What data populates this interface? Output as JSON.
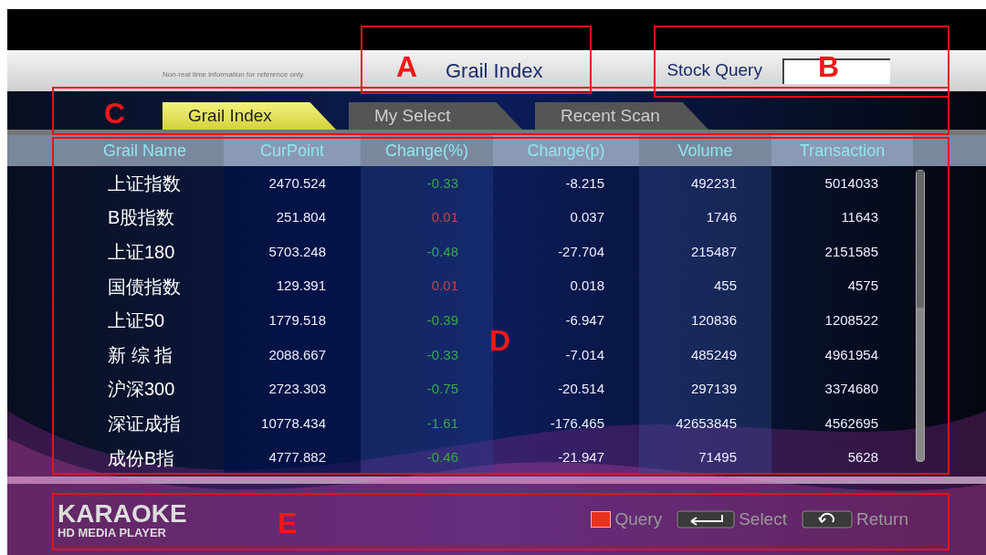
{
  "header": {
    "notice": "Non-real time information for reference only.",
    "title": "Grail Index",
    "query_label": "Stock Query"
  },
  "tabs": [
    {
      "label": "Grail Index",
      "selected": true
    },
    {
      "label": "My Select",
      "selected": false
    },
    {
      "label": "Recent Scan",
      "selected": false
    }
  ],
  "table": {
    "columns": [
      "Grail Name",
      "CurPoint",
      "Change(%)",
      "Change(p)",
      "Volume",
      "Transaction"
    ],
    "rows": [
      {
        "name": "上证指数",
        "cur_point": "2470.524",
        "change_pct": "-0.33",
        "color": "#3aa64a",
        "change_p": "-8.215",
        "volume": "492231",
        "transaction": "5014033"
      },
      {
        "name": "B股指数",
        "cur_point": "251.804",
        "change_pct": "0.01",
        "color": "#c8424a",
        "change_p": "0.037",
        "volume": "1746",
        "transaction": "11643"
      },
      {
        "name": "上证180",
        "cur_point": "5703.248",
        "change_pct": "-0.48",
        "color": "#3aa64a",
        "change_p": "-27.704",
        "volume": "215487",
        "transaction": "2151585"
      },
      {
        "name": "国债指数",
        "cur_point": "129.391",
        "change_pct": "0.01",
        "color": "#c8424a",
        "change_p": "0.018",
        "volume": "455",
        "transaction": "4575"
      },
      {
        "name": "上证50",
        "cur_point": "1779.518",
        "change_pct": "-0.39",
        "color": "#3aa64a",
        "change_p": "-6.947",
        "volume": "120836",
        "transaction": "1208522"
      },
      {
        "name": "新 综 指",
        "cur_point": "2088.667",
        "change_pct": "-0.33",
        "color": "#3aa64a",
        "change_p": "-7.014",
        "volume": "485249",
        "transaction": "4961954"
      },
      {
        "name": "沪深300",
        "cur_point": "2723.303",
        "change_pct": "-0.75",
        "color": "#3aa64a",
        "change_p": "-20.514",
        "volume": "297139",
        "transaction": "3374680"
      },
      {
        "name": "深证成指",
        "cur_point": "10778.434",
        "change_pct": "-1.61",
        "color": "#3aa64a",
        "change_p": "-176.465",
        "volume": "42653845",
        "transaction": "4562695"
      },
      {
        "name": "成份B指",
        "cur_point": "4777.882",
        "change_pct": "-0.46",
        "color": "#3aa64a",
        "change_p": "-21.947",
        "volume": "71495",
        "transaction": "5628"
      }
    ]
  },
  "footer": {
    "logo_title": "KARAOKE",
    "logo_subtitle": "HD MEDIA PLAYER",
    "hints": [
      {
        "kind": "red-key",
        "label": "Query"
      },
      {
        "kind": "enter-key",
        "label": "Select"
      },
      {
        "kind": "return-key",
        "label": "Return"
      }
    ]
  },
  "annotations": [
    {
      "label": "A"
    },
    {
      "label": "B"
    },
    {
      "label": "C"
    },
    {
      "label": "D"
    },
    {
      "label": "E"
    }
  ]
}
